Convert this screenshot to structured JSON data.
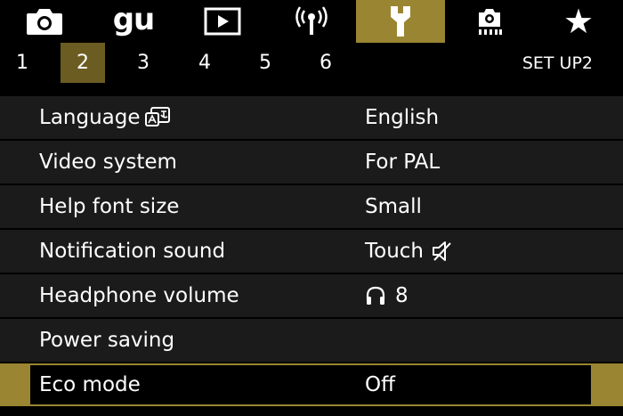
{
  "tabs": [
    {
      "icon": "camera-icon",
      "active": false
    },
    {
      "icon": "gu-icon",
      "text": "gu",
      "active": false
    },
    {
      "icon": "playback-icon",
      "active": false
    },
    {
      "icon": "wireless-icon",
      "active": false
    },
    {
      "icon": "wrench-icon",
      "active": true
    },
    {
      "icon": "custom-function-icon",
      "active": false
    },
    {
      "icon": "my-menu-star-icon",
      "active": false
    }
  ],
  "pages": [
    "1",
    "2",
    "3",
    "4",
    "5",
    "6"
  ],
  "active_page": "2",
  "section_label": "SET UP2",
  "menu": [
    {
      "label": "Language",
      "value": "English",
      "label_icon": "language-icon"
    },
    {
      "label": "Video system",
      "value": "For PAL"
    },
    {
      "label": "Help font size",
      "value": "Small"
    },
    {
      "label": "Notification sound",
      "value": "Touch",
      "value_icon": "speaker-muted-icon"
    },
    {
      "label": "Headphone volume",
      "value": "8",
      "value_icon": "headphone-icon"
    },
    {
      "label": "Power saving",
      "value": ""
    },
    {
      "label": "Eco mode",
      "value": "Off",
      "selected": true
    }
  ],
  "colors": {
    "accent": "#9a8532",
    "active_page": "#6b5d22",
    "row_bg": "#1b1b1b",
    "background": "#000000"
  }
}
